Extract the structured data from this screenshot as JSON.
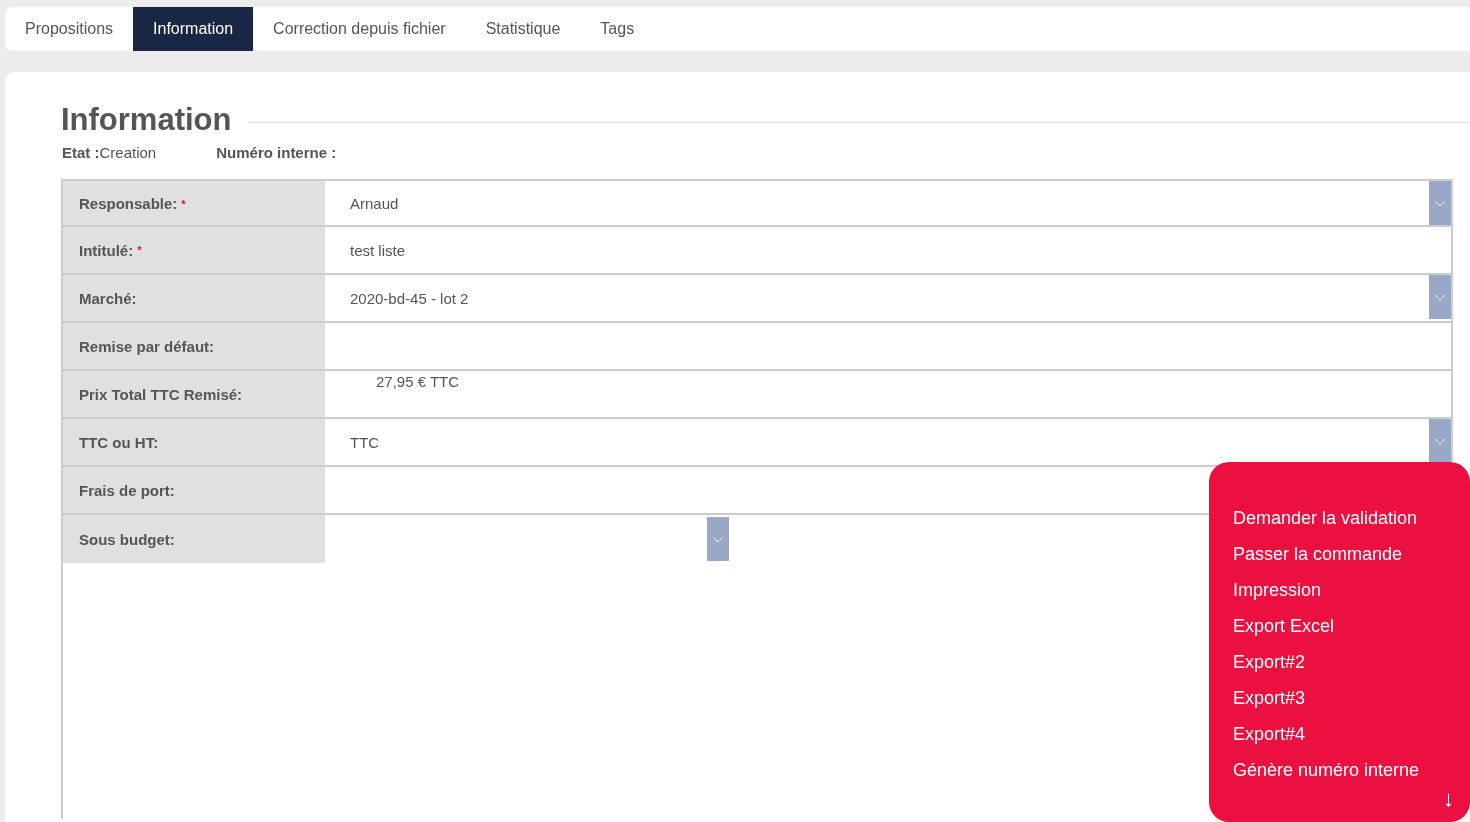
{
  "tabs": [
    {
      "label": "Propositions",
      "selected": false
    },
    {
      "label": "Information",
      "selected": true
    },
    {
      "label": "Correction depuis fichier",
      "selected": false
    },
    {
      "label": "Statistique",
      "selected": false
    },
    {
      "label": "Tags",
      "selected": false
    }
  ],
  "section": {
    "title": "Information",
    "state_label": "Etat :",
    "state_value": "Creation",
    "internal_number_label": "Numéro interne :"
  },
  "fields": [
    {
      "label": "Responsable:",
      "required_mark": "*",
      "kind": "select",
      "value": "Arnaud"
    },
    {
      "label": "Intitulé:",
      "required_mark": "*",
      "kind": "text",
      "value": "test liste"
    },
    {
      "label": "Marché:",
      "kind": "select",
      "value": "2020-bd-45 - lot 2"
    },
    {
      "label": "Remise par défaut:",
      "kind": "text"
    },
    {
      "label": "Prix Total TTC Remisé:",
      "kind": "static",
      "value": "27,95 € TTC"
    },
    {
      "label": "TTC ou HT:",
      "kind": "select",
      "value": "TTC"
    },
    {
      "label": "Frais de port:",
      "kind": "text"
    },
    {
      "label": "Sous budget:",
      "kind": "short-select"
    }
  ],
  "actions_menu": {
    "items": [
      "Demander la validation",
      "Passer la commande",
      "Impression",
      "Export Excel",
      "Export#2",
      "Export#3",
      "Export#4",
      "Génère numéro interne"
    ],
    "scroll_glyph": "↓"
  }
}
